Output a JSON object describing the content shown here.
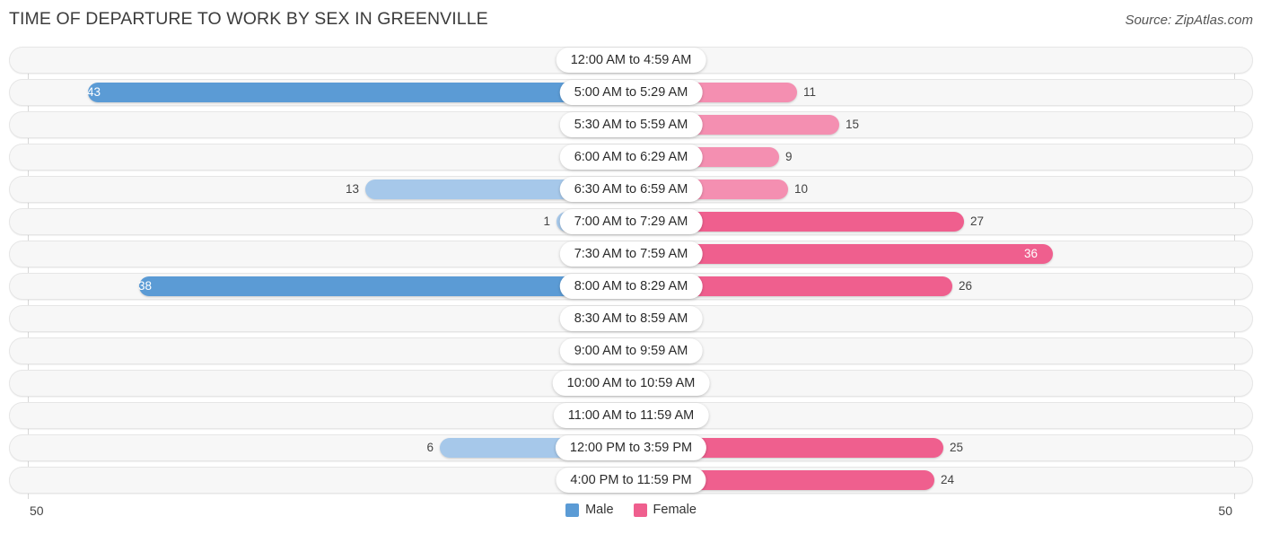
{
  "header": {
    "title": "TIME OF DEPARTURE TO WORK BY SEX IN GREENVILLE",
    "source": "Source: ZipAtlas.com"
  },
  "axis": {
    "left_max": "50",
    "right_max": "50"
  },
  "legend": {
    "items": [
      {
        "label": "Male",
        "color": "#5b9bd5"
      },
      {
        "label": "Female",
        "color": "#ef5f8e"
      }
    ]
  },
  "colors": {
    "male_light": "#a6c8ea",
    "male_dark": "#5b9bd5",
    "female_light": "#f7aac3",
    "female_mid": "#f48fb1",
    "female_dark": "#ef5f8e",
    "track": "#f7f7f7",
    "gridline": "#d8d8d8"
  },
  "chart_data": {
    "type": "bar",
    "orientation": "horizontal-diverging",
    "title": "TIME OF DEPARTURE TO WORK BY SEX IN GREENVILLE",
    "xlabel": "",
    "ylabel": "",
    "xlim": [
      50,
      50
    ],
    "grid": true,
    "legend_position": "bottom-center",
    "categories": [
      "12:00 AM to 4:59 AM",
      "5:00 AM to 5:29 AM",
      "5:30 AM to 5:59 AM",
      "6:00 AM to 6:29 AM",
      "6:30 AM to 6:59 AM",
      "7:00 AM to 7:29 AM",
      "7:30 AM to 7:59 AM",
      "8:00 AM to 8:29 AM",
      "8:30 AM to 8:59 AM",
      "9:00 AM to 9:59 AM",
      "10:00 AM to 10:59 AM",
      "11:00 AM to 11:59 AM",
      "12:00 PM to 3:59 PM",
      "4:00 PM to 11:59 PM"
    ],
    "series": [
      {
        "name": "Male",
        "color": "#5b9bd5",
        "values": [
          0,
          43,
          0,
          0,
          13,
          1,
          0,
          38,
          0,
          0,
          0,
          0,
          6,
          0
        ]
      },
      {
        "name": "Female",
        "color": "#ef5f8e",
        "values": [
          0,
          11,
          15,
          9,
          10,
          27,
          36,
          26,
          0,
          0,
          0,
          0,
          25,
          24
        ]
      }
    ]
  },
  "rows": [
    {
      "category": "12:00 AM to 4:59 AM",
      "male": "0",
      "female": "0",
      "male_w": 65,
      "female_w": 65,
      "male_shade": "light",
      "female_shade": "light",
      "male_inside": false,
      "female_inside": false
    },
    {
      "category": "5:00 AM to 5:29 AM",
      "male": "43",
      "female": "11",
      "male_w": 605,
      "female_w": 185,
      "male_shade": "dark",
      "female_shade": "mid",
      "male_inside": true,
      "female_inside": false
    },
    {
      "category": "5:30 AM to 5:59 AM",
      "male": "0",
      "female": "15",
      "male_w": 65,
      "female_w": 232,
      "male_shade": "light",
      "female_shade": "mid",
      "male_inside": false,
      "female_inside": false
    },
    {
      "category": "6:00 AM to 6:29 AM",
      "male": "0",
      "female": "9",
      "male_w": 65,
      "female_w": 165,
      "male_shade": "light",
      "female_shade": "mid",
      "male_inside": false,
      "female_inside": false
    },
    {
      "category": "6:30 AM to 6:59 AM",
      "male": "13",
      "female": "10",
      "male_w": 296,
      "female_w": 175,
      "male_shade": "light",
      "female_shade": "mid",
      "male_inside": false,
      "female_inside": false
    },
    {
      "category": "7:00 AM to 7:29 AM",
      "male": "1",
      "female": "27",
      "male_w": 83,
      "female_w": 371,
      "male_shade": "light",
      "female_shade": "dark",
      "male_inside": false,
      "female_inside": false
    },
    {
      "category": "7:30 AM to 7:59 AM",
      "male": "0",
      "female": "36",
      "male_w": 65,
      "female_w": 470,
      "male_shade": "light",
      "female_shade": "dark",
      "male_inside": false,
      "female_inside": true
    },
    {
      "category": "8:00 AM to 8:29 AM",
      "male": "38",
      "female": "26",
      "male_w": 548,
      "female_w": 358,
      "male_shade": "dark",
      "female_shade": "dark",
      "male_inside": true,
      "female_inside": false
    },
    {
      "category": "8:30 AM to 8:59 AM",
      "male": "0",
      "female": "0",
      "male_w": 65,
      "female_w": 65,
      "male_shade": "light",
      "female_shade": "mid",
      "male_inside": false,
      "female_inside": false
    },
    {
      "category": "9:00 AM to 9:59 AM",
      "male": "0",
      "female": "0",
      "male_w": 65,
      "female_w": 65,
      "male_shade": "light",
      "female_shade": "mid",
      "male_inside": false,
      "female_inside": false
    },
    {
      "category": "10:00 AM to 10:59 AM",
      "male": "0",
      "female": "0",
      "male_w": 65,
      "female_w": 65,
      "male_shade": "light",
      "female_shade": "mid",
      "male_inside": false,
      "female_inside": false
    },
    {
      "category": "11:00 AM to 11:59 AM",
      "male": "0",
      "female": "0",
      "male_w": 65,
      "female_w": 65,
      "male_shade": "light",
      "female_shade": "mid",
      "male_inside": false,
      "female_inside": false
    },
    {
      "category": "12:00 PM to 3:59 PM",
      "male": "6",
      "female": "25",
      "male_w": 213,
      "female_w": 348,
      "male_shade": "light",
      "female_shade": "dark",
      "male_inside": false,
      "female_inside": false
    },
    {
      "category": "4:00 PM to 11:59 PM",
      "male": "0",
      "female": "24",
      "male_w": 65,
      "female_w": 338,
      "male_shade": "light",
      "female_shade": "dark",
      "male_inside": false,
      "female_inside": false
    }
  ]
}
